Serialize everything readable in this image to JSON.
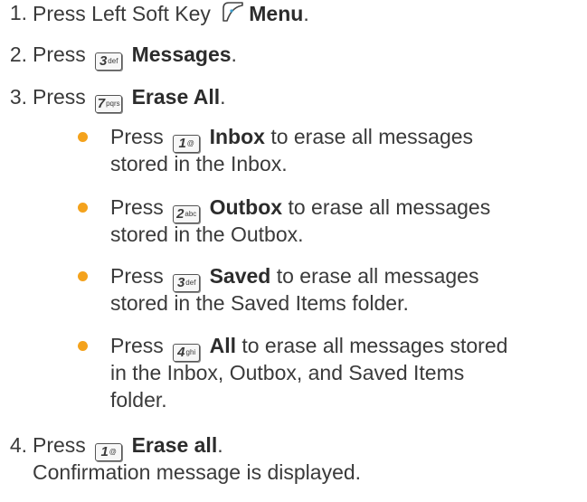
{
  "steps": [
    {
      "num": "1.",
      "prefix": "Press Left Soft Key",
      "key_icon": "left-soft-key-icon",
      "label": "Menu",
      "suffix": "."
    },
    {
      "num": "2.",
      "prefix": "Press",
      "key_digit": "3",
      "key_letters": "def",
      "label": "Messages",
      "suffix": "."
    },
    {
      "num": "3.",
      "prefix": "Press",
      "key_digit": "7",
      "key_letters": "pqrs",
      "label": "Erase All",
      "suffix": "."
    },
    {
      "num": "4.",
      "prefix": "Press",
      "key_digit": "1",
      "key_letters": "@",
      "label": "Erase all",
      "suffix": ".",
      "note": "Confirmation message is displayed."
    }
  ],
  "bullets": [
    {
      "prefix": "Press",
      "key_digit": "1",
      "key_letters": "@",
      "label": "Inbox",
      "line1": "to erase all messages",
      "line2": "stored in the Inbox."
    },
    {
      "prefix": "Press",
      "key_digit": "2",
      "key_letters": "abc",
      "label": "Outbox",
      "line1": "to erase all messages",
      "line2": "stored in the Outbox."
    },
    {
      "prefix": "Press",
      "key_digit": "3",
      "key_letters": "def",
      "label": "Saved",
      "line1": "to erase all messages",
      "line2": "stored in the Saved Items folder."
    },
    {
      "prefix": "Press",
      "key_digit": "4",
      "key_letters": "ghi",
      "label": "All",
      "line1": "to erase all messages stored",
      "line2": "in the Inbox, Outbox, and Saved Items",
      "line3": "folder."
    }
  ],
  "colors": {
    "bullet": "#f4a21c",
    "text": "#3a3a3a"
  }
}
